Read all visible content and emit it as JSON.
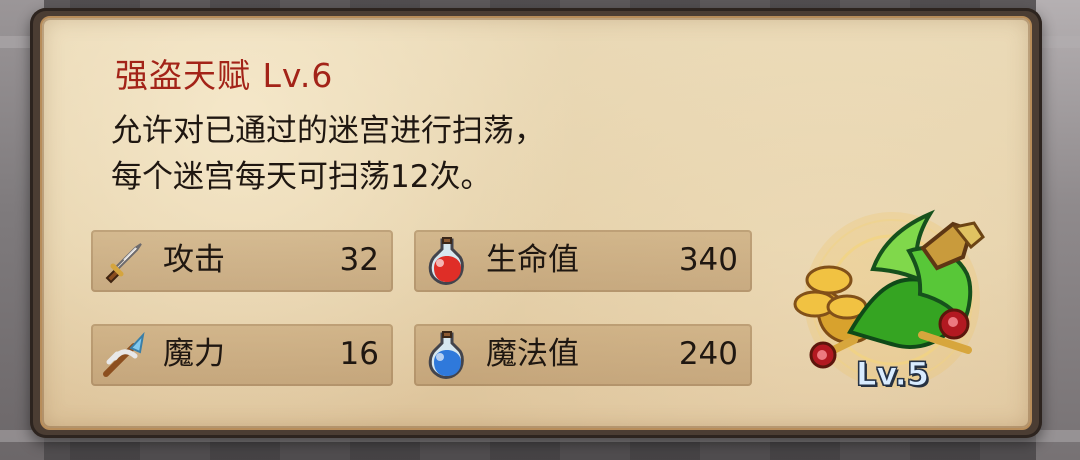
{
  "panel": {
    "title": "强盗天赋 Lv.6",
    "description_lines": [
      "允许对已通过的迷宫进行扫荡，",
      "每个迷宫每天可扫荡12次。"
    ],
    "stats": [
      {
        "label": "攻击",
        "value": "32",
        "icon": "sword-icon"
      },
      {
        "label": "生命值",
        "value": "340",
        "icon": "red-potion-icon"
      },
      {
        "label": "魔力",
        "value": "16",
        "icon": "magic-staff-icon"
      },
      {
        "label": "魔法值",
        "value": "240",
        "icon": "blue-potion-icon"
      }
    ],
    "emblem": {
      "icon": "bandit-talent-emblem-icon",
      "level_label": "Lv.5"
    }
  },
  "colors": {
    "title": "#a32318",
    "text": "#1f1711",
    "parchment": "#e6d3ac",
    "stat_row": "#b98e60",
    "emblem_green": "#46b52b",
    "emblem_gold": "#d8a22d"
  }
}
